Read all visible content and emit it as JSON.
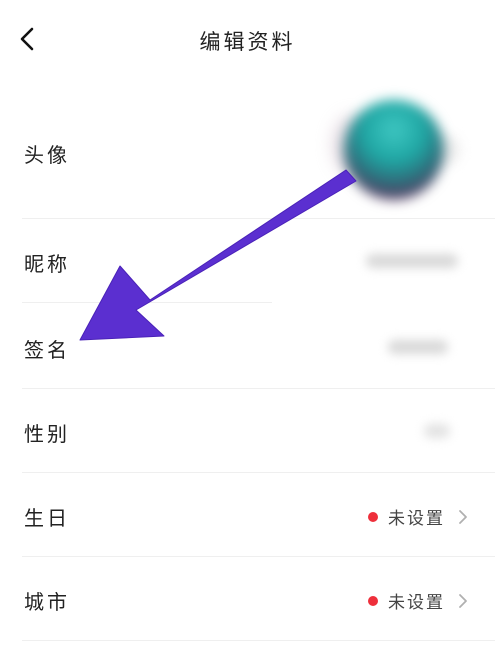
{
  "header": {
    "title": "编辑资料"
  },
  "rows": {
    "avatar_label": "头像",
    "nickname_label": "昵称",
    "signature_label": "签名",
    "gender_label": "性别",
    "birthday_label": "生日",
    "birthday_value": "未设置",
    "city_label": "城市",
    "city_value": "未设置"
  },
  "icons": {
    "back": "chevron-left-icon",
    "row_arrow": "chevron-right-icon",
    "status_dot": "red-dot-icon"
  },
  "colors": {
    "status_dot": "#ee2f3b",
    "annotation_arrow": "#5b2fd0"
  }
}
